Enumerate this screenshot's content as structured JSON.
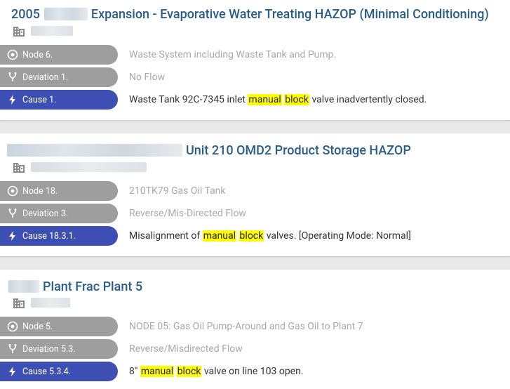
{
  "cards": [
    {
      "title_prefix": "2005",
      "title": "Expansion - Evaporative Water Treating HAZOP (Minimal Conditioning)",
      "node": "Node 6.",
      "node_desc": "Waste System including Waste Tank and Pump.",
      "deviation": "Deviation 1.",
      "deviation_desc": "No Flow",
      "cause": "Cause 1.",
      "cause_pre": "Waste Tank 92C-7345 inlet ",
      "cause_hl1": "manual",
      "cause_mid": " ",
      "cause_hl2": "block",
      "cause_post": " valve inadvertently closed."
    },
    {
      "title_prefix": "",
      "title": "Unit 210 OMD2 Product Storage HAZOP",
      "node": "Node 18.",
      "node_desc": "210TK79 Gas Oil Tank",
      "deviation": "Deviation 3.",
      "deviation_desc": "Reverse/Mis-Directed Flow",
      "cause": "Cause 18.3.1.",
      "cause_pre": "Misalignment of ",
      "cause_hl1": "manual",
      "cause_mid": " ",
      "cause_hl2": "block",
      "cause_post": " valves. [Operating Mode: Normal]"
    },
    {
      "title_prefix": "",
      "title": "Plant Frac Plant 5",
      "node": "Node 5.",
      "node_desc": "NODE 05: Gas Oil Pump-Around and Gas Oil to Plant 7",
      "deviation": "Deviation 5.3.",
      "deviation_desc": "Reverse/Misdirected Flow",
      "cause": "Cause 5.3.4.",
      "cause_pre": "8\" ",
      "cause_hl1": "manual",
      "cause_mid": " ",
      "cause_hl2": "block",
      "cause_post": " valve on line 103 open."
    }
  ],
  "colors": {
    "title": "#2a5c8a",
    "node_pill": "#9e9e9e",
    "cause_pill": "#3e4fb4",
    "highlight": "#ffff00"
  },
  "icons": {
    "node": "target-circle-icon",
    "deviation": "fork-icon",
    "cause": "lightning-icon",
    "facility": "building-icon"
  }
}
